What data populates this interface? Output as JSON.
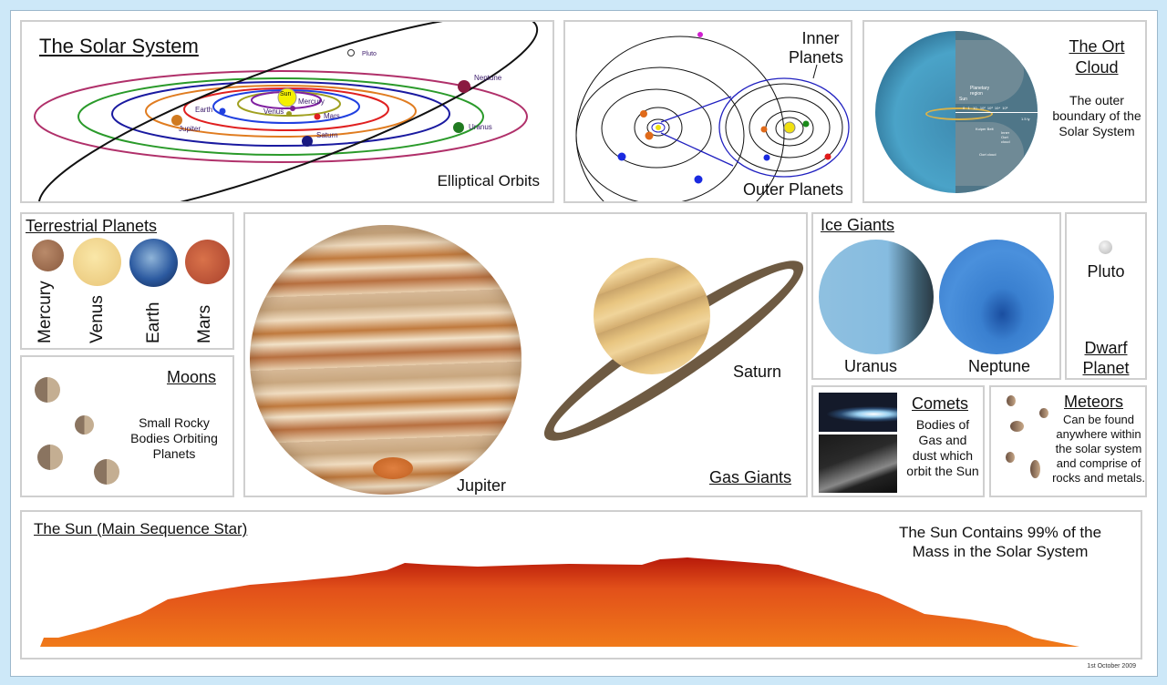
{
  "solar_system": {
    "title": "The Solar System",
    "subtitle": "Elliptical Orbits",
    "labels": {
      "sun": "Sun",
      "mercury": "Mercury",
      "venus": "Venus",
      "earth": "Earth",
      "mars": "Mars",
      "jupiter": "Jupiter",
      "saturn": "Saturn",
      "uranus": "Uranus",
      "neptune": "Neptune",
      "pluto": "Pluto"
    }
  },
  "orbits": {
    "inner_label_1": "Inner",
    "inner_label_2": "Planets",
    "outer_label": "Outer Planets"
  },
  "ort": {
    "title_1": "The Ort",
    "title_2": "Cloud",
    "desc_1": "The outer",
    "desc_2": "boundary of the",
    "desc_3": "Solar System",
    "diagram_labels": {
      "planetary": "Planetary",
      "region": "region",
      "sun": "Sun",
      "kuiper": "Kuiper Belt",
      "inner_oort_1": "Inner",
      "inner_oort_2": "Oort",
      "inner_oort_3": "cloud",
      "oort": "Oort cloud",
      "scale": "0   1   10   10²  10³  10⁴  10⁵",
      "ly": "1.5 ly"
    }
  },
  "terrestrial": {
    "title": "Terrestrial Planets",
    "planets": [
      {
        "name": "Mercury",
        "color": "#9a6a4c"
      },
      {
        "name": "Venus",
        "color": "#f1d38b"
      },
      {
        "name": "Earth",
        "color": "#2f5ba8"
      },
      {
        "name": "Mars",
        "color": "#c1513a"
      }
    ]
  },
  "moons": {
    "title": "Moons",
    "desc_1": "Small Rocky",
    "desc_2": "Bodies Orbiting",
    "desc_3": "Planets"
  },
  "gas_giants": {
    "title": "Gas Giants",
    "jupiter": "Jupiter",
    "saturn": "Saturn"
  },
  "ice_giants": {
    "title": "Ice Giants",
    "uranus": "Uranus",
    "neptune": "Neptune"
  },
  "dwarf": {
    "pluto": "Pluto",
    "title_1": "Dwarf",
    "title_2": "Planet"
  },
  "comets": {
    "title": "Comets",
    "desc_1": "Bodies of",
    "desc_2": "Gas and",
    "desc_3": "dust which",
    "desc_4": "orbit the Sun"
  },
  "meteors": {
    "title": "Meteors",
    "desc_1": "Can be found",
    "desc_2": "anywhere within",
    "desc_3": "the solar system",
    "desc_4": "and comprise of",
    "desc_5": "rocks and metals."
  },
  "sun": {
    "title": "The Sun (Main Sequence Star)",
    "fact_1": "The Sun Contains 99% of the",
    "fact_2": "Mass in the Solar System"
  },
  "footer": {
    "date": "1st October 2009"
  },
  "colors": {
    "frame": "#cde8f8",
    "panel_border": "#cfcfcf",
    "sun_surface": "#e8550c"
  }
}
